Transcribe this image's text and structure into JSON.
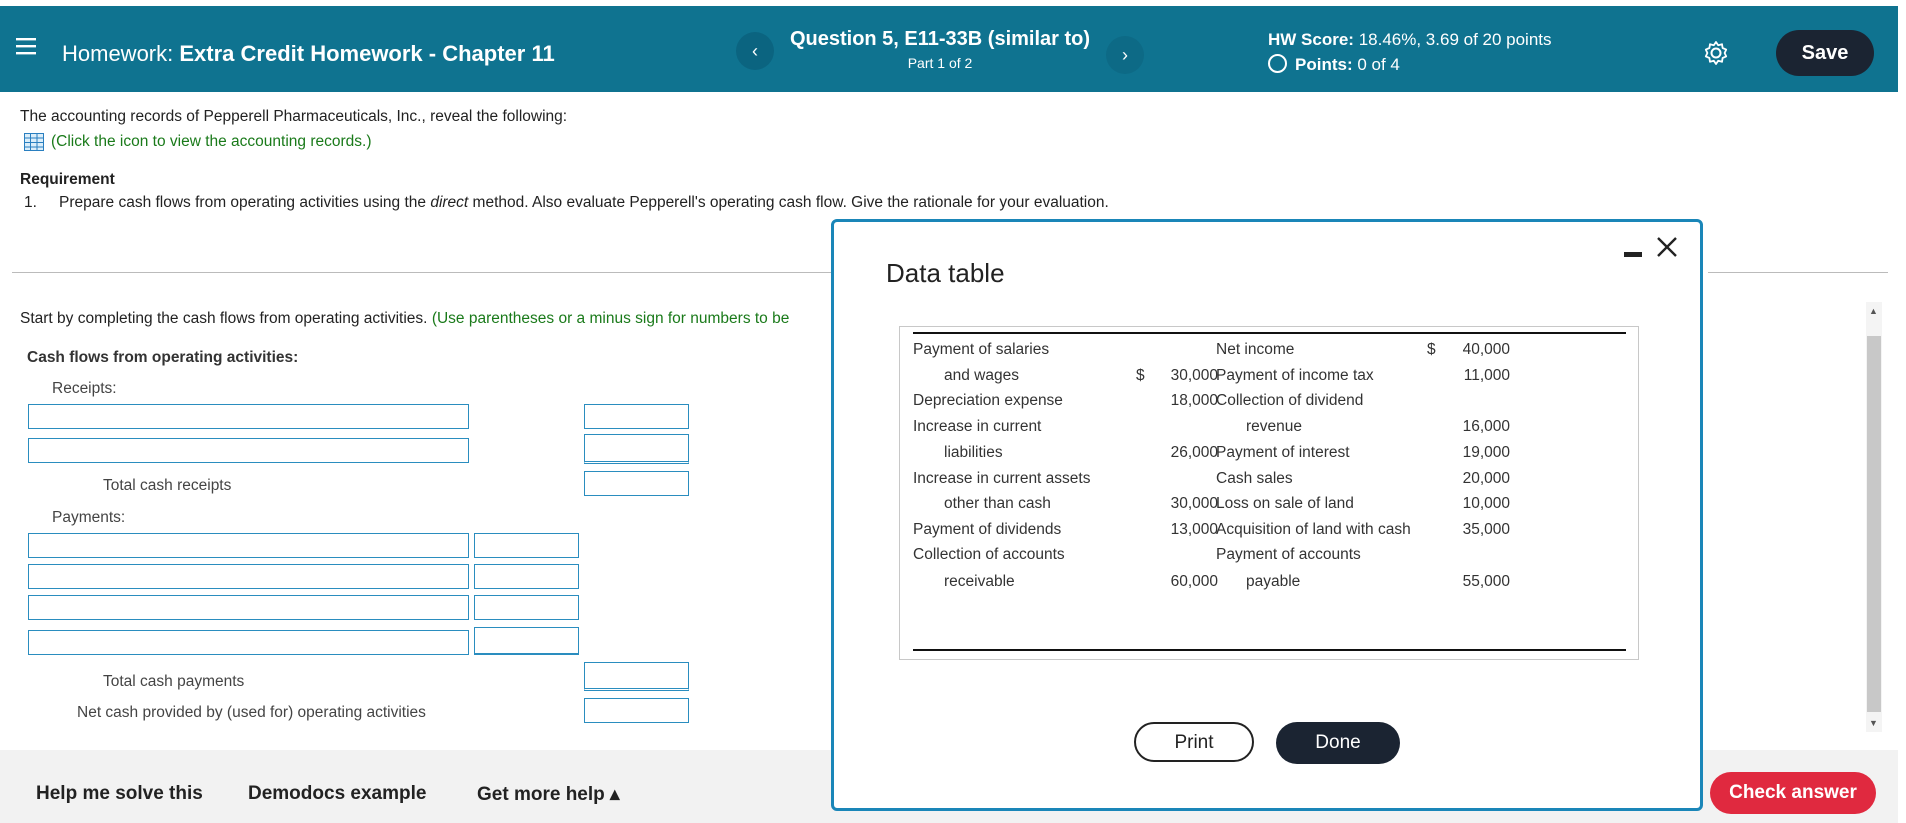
{
  "header": {
    "menu_icon": "hamburger-icon",
    "hw_prefix": "Homework:",
    "hw_title": "Extra Credit Homework - Chapter 11",
    "prev_icon": "‹",
    "next_icon": "›",
    "question": "Question 5, E11-33B (similar to)",
    "part": "Part 1 of 2",
    "hw_score_label": "HW Score:",
    "hw_score_value": "18.46%, 3.69 of 20 points",
    "points_label": "Points:",
    "points_value": "0 of 4",
    "save_label": "Save"
  },
  "problem": {
    "intro": "The accounting records of Pepperell Pharmaceuticals, Inc., reveal the following:",
    "link": "(Click the icon to view the accounting records.)",
    "requirement_heading": "Requirement",
    "req_number": "1.",
    "req_text_before": "Prepare cash flows from operating activities using the ",
    "req_text_em": "direct",
    "req_text_after": " method. Also evaluate Pepperell's operating cash flow. Give the rationale for your evaluation."
  },
  "work": {
    "instruction": "Start by completing the cash flows from operating activities.",
    "instruction_hint": "(Use parentheses or a minus sign for numbers to be",
    "section_heading": "Cash flows from operating activities:",
    "receipts_label": "Receipts:",
    "total_receipts": "Total cash receipts",
    "payments_label": "Payments:",
    "total_payments": "Total cash payments",
    "net_cash": "Net cash provided by (used for) operating activities"
  },
  "modal": {
    "title": "Data table",
    "left_rows": [
      {
        "label": "Payment of salaries",
        "indent": false,
        "currency": "",
        "value": ""
      },
      {
        "label": "and wages",
        "indent": true,
        "currency": "$",
        "value": "30,000"
      },
      {
        "label": "Depreciation expense",
        "indent": false,
        "currency": "",
        "value": "18,000"
      },
      {
        "label": "Increase in current",
        "indent": false,
        "currency": "",
        "value": ""
      },
      {
        "label": "liabilities",
        "indent": true,
        "currency": "",
        "value": "26,000"
      },
      {
        "label": "Increase in current assets",
        "indent": false,
        "currency": "",
        "value": ""
      },
      {
        "label": "other than cash",
        "indent": true,
        "currency": "",
        "value": "30,000"
      },
      {
        "label": "Payment of dividends",
        "indent": false,
        "currency": "",
        "value": "13,000"
      },
      {
        "label": "Collection of accounts",
        "indent": false,
        "currency": "",
        "value": ""
      },
      {
        "label": "receivable",
        "indent": true,
        "currency": "",
        "value": "60,000"
      }
    ],
    "right_rows": [
      {
        "label": "Net income",
        "indent": false,
        "currency": "$",
        "value": "40,000"
      },
      {
        "label": "Payment of income tax",
        "indent": false,
        "currency": "",
        "value": "11,000"
      },
      {
        "label": "Collection of dividend",
        "indent": false,
        "currency": "",
        "value": ""
      },
      {
        "label": "revenue",
        "indent": true,
        "currency": "",
        "value": "16,000"
      },
      {
        "label": "Payment of interest",
        "indent": false,
        "currency": "",
        "value": "19,000"
      },
      {
        "label": "Cash sales",
        "indent": false,
        "currency": "",
        "value": "20,000"
      },
      {
        "label": "Loss on sale of land",
        "indent": false,
        "currency": "",
        "value": "10,000"
      },
      {
        "label": "Acquisition of land with cash",
        "indent": false,
        "currency": "",
        "value": "35,000"
      },
      {
        "label": "Payment of accounts",
        "indent": false,
        "currency": "",
        "value": ""
      },
      {
        "label": "payable",
        "indent": true,
        "currency": "",
        "value": "55,000"
      }
    ],
    "print_label": "Print",
    "done_label": "Done"
  },
  "footer": {
    "help": "Help me solve this",
    "demodocs": "Demodocs example",
    "more_help": "Get more help ▴",
    "check": "Check answer"
  }
}
